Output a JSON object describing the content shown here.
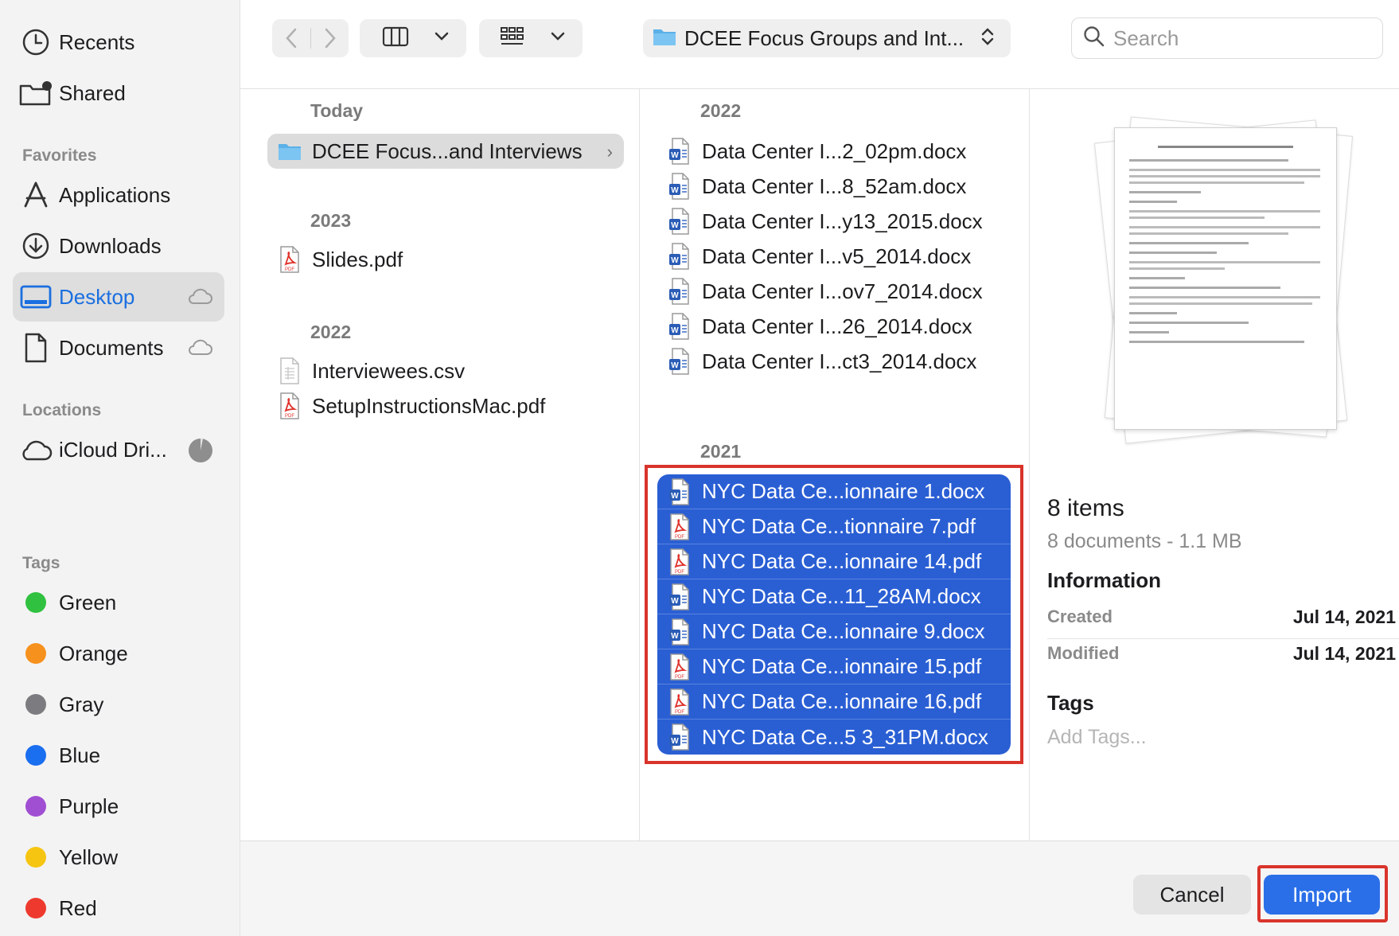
{
  "sidebar": {
    "items_top": [
      {
        "label": "Recents",
        "icon": "clock-icon"
      },
      {
        "label": "Shared",
        "icon": "shared-folder-icon"
      }
    ],
    "favorites_header": "Favorites",
    "favorites": [
      {
        "label": "Applications",
        "icon": "applications-icon"
      },
      {
        "label": "Downloads",
        "icon": "download-icon"
      },
      {
        "label": "Desktop",
        "icon": "desktop-icon",
        "selected": true
      },
      {
        "label": "Documents",
        "icon": "document-icon"
      }
    ],
    "locations_header": "Locations",
    "locations": [
      {
        "label": "iCloud Dri...",
        "icon": "cloud-icon"
      }
    ],
    "tags_header": "Tags",
    "tags": [
      {
        "label": "Green",
        "color": "#2fc13f"
      },
      {
        "label": "Orange",
        "color": "#f6911e"
      },
      {
        "label": "Gray",
        "color": "#7c7c80"
      },
      {
        "label": "Blue",
        "color": "#1a6ef0"
      },
      {
        "label": "Purple",
        "color": "#a04fd3"
      },
      {
        "label": "Yellow",
        "color": "#f6c511"
      },
      {
        "label": "Red",
        "color": "#ee3a2e"
      }
    ]
  },
  "toolbar": {
    "path_label": "DCEE Focus Groups and Int...",
    "search_placeholder": "Search"
  },
  "column1": {
    "sections": [
      {
        "header": "Today",
        "files": [
          {
            "name": "DCEE Focus...and Interviews",
            "type": "folder",
            "selected": true
          }
        ]
      },
      {
        "header": "2023",
        "files": [
          {
            "name": "Slides.pdf",
            "type": "pdf"
          }
        ]
      },
      {
        "header": "2022",
        "files": [
          {
            "name": "Interviewees.csv",
            "type": "csv"
          },
          {
            "name": "SetupInstructionsMac.pdf",
            "type": "pdf"
          }
        ]
      }
    ]
  },
  "column2": {
    "sections": [
      {
        "header": "2022",
        "files": [
          {
            "name": "Data Center I...2_02pm.docx",
            "type": "docx"
          },
          {
            "name": "Data Center I...8_52am.docx",
            "type": "docx"
          },
          {
            "name": "Data Center I...y13_2015.docx",
            "type": "docx"
          },
          {
            "name": "Data Center I...v5_2014.docx",
            "type": "docx"
          },
          {
            "name": "Data Center I...ov7_2014.docx",
            "type": "docx"
          },
          {
            "name": "Data Center I...26_2014.docx",
            "type": "docx"
          },
          {
            "name": "Data Center I...ct3_2014.docx",
            "type": "docx"
          }
        ]
      },
      {
        "header": "2021",
        "files": [
          {
            "name": "NYC Data Ce...ionnaire 1.docx",
            "type": "docx",
            "selected": true
          },
          {
            "name": "NYC Data Ce...tionnaire 7.pdf",
            "type": "pdf",
            "selected": true
          },
          {
            "name": "NYC Data Ce...ionnaire 14.pdf",
            "type": "pdf",
            "selected": true
          },
          {
            "name": "NYC Data Ce...11_28AM.docx",
            "type": "docx",
            "selected": true
          },
          {
            "name": "NYC Data Ce...ionnaire 9.docx",
            "type": "docx",
            "selected": true
          },
          {
            "name": "NYC Data Ce...ionnaire 15.pdf",
            "type": "pdf",
            "selected": true
          },
          {
            "name": "NYC Data Ce...ionnaire 16.pdf",
            "type": "pdf",
            "selected": true
          },
          {
            "name": "NYC Data Ce...5 3_31PM.docx",
            "type": "docx",
            "selected": true
          }
        ]
      }
    ]
  },
  "preview": {
    "title": "8 items",
    "subtitle": "8 documents - 1.1 MB",
    "info_header": "Information",
    "created_label": "Created",
    "created_value": "Jul 14, 2021",
    "modified_label": "Modified",
    "modified_value": "Jul 14, 2021",
    "tags_header": "Tags",
    "tags_placeholder": "Add Tags..."
  },
  "buttons": {
    "cancel": "Cancel",
    "import": "Import"
  },
  "colors": {
    "accent": "#2a6fe8",
    "selection": "#2a5fd4",
    "highlight": "#d9342b"
  }
}
